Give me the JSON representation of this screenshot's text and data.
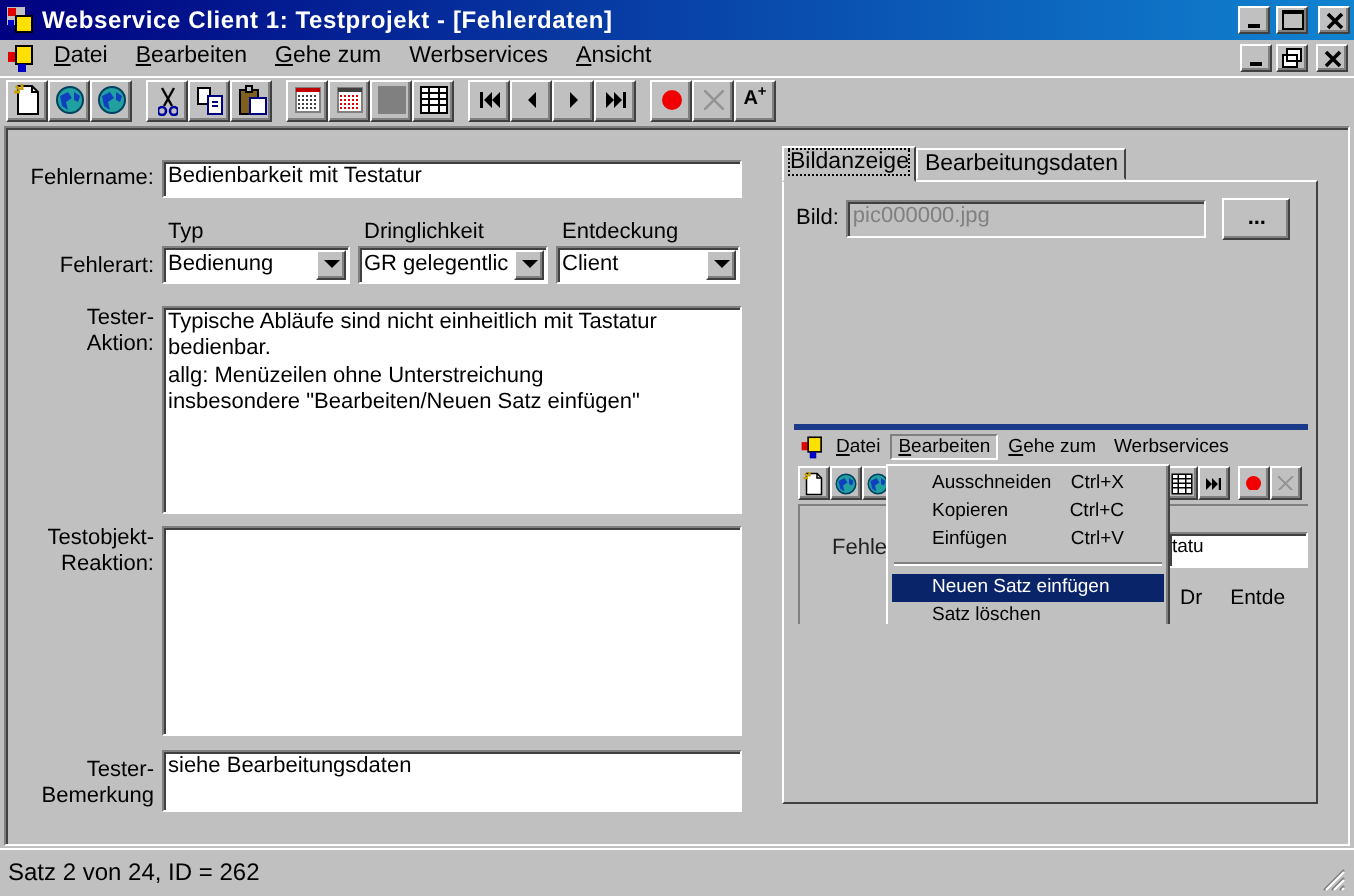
{
  "window": {
    "title": "Webservice Client 1: Testprojekt - [Fehlerdaten]"
  },
  "menu": [
    {
      "label": "Datei",
      "mnemonic": true
    },
    {
      "label": "Bearbeiten",
      "mnemonic": true
    },
    {
      "label": "Gehe zum",
      "mnemonic": true
    },
    {
      "label": "Werbservices",
      "mnemonic": false
    },
    {
      "label": "Ansicht",
      "mnemonic": true
    }
  ],
  "toolbar": [
    [
      {
        "kind": "new",
        "disabled": false
      },
      {
        "kind": "globe",
        "disabled": false
      },
      {
        "kind": "globe",
        "disabled": false
      }
    ],
    [
      {
        "kind": "cut",
        "disabled": false
      },
      {
        "kind": "copy",
        "disabled": false
      },
      {
        "kind": "paste",
        "disabled": false
      }
    ],
    [
      {
        "kind": "list",
        "disabled": false
      },
      {
        "kind": "redlist",
        "disabled": false
      },
      {
        "kind": "square",
        "disabled": false
      },
      {
        "kind": "table",
        "disabled": false
      }
    ],
    [
      {
        "kind": "first",
        "disabled": false
      },
      {
        "kind": "prev",
        "disabled": false
      },
      {
        "kind": "next",
        "disabled": false
      },
      {
        "kind": "last",
        "disabled": false
      }
    ],
    [
      {
        "kind": "record",
        "disabled": false
      },
      {
        "kind": "delete",
        "disabled": true
      },
      {
        "kind": "text",
        "label": "A$^{+}$",
        "disabled": false
      }
    ]
  ],
  "form": {
    "name": {
      "label": "Fehlername:",
      "value": "Bedienbarkeit mit Testatur"
    },
    "type": {
      "label": "Fehlerart:",
      "combos": [
        {
          "heading": "Typ",
          "value": "Bedienung"
        },
        {
          "heading": "Dringlichkeit",
          "value": "GR gelegentlic"
        },
        {
          "heading": "Entdeckung",
          "value": "Client"
        }
      ]
    },
    "memos": [
      {
        "label": "Tester-Aktion:",
        "lines": [
          "Typische Abläufe sind nicht einheitlich mit Tastatur bedienbar.",
          "allg: Menüzeilen ohne Unterstreichung",
          "insbesondere \"Bearbeiten/Neuen Satz einfügen\""
        ]
      },
      {
        "label": "Testobjekt-Reaktion:"
      },
      {
        "label": "Tester-Bemerkung",
        "lines": [
          "siehe Bearbeitungsdaten"
        ]
      }
    ]
  },
  "panel": {
    "tabs": [
      {
        "label": "Bildanzeige",
        "selected": true
      },
      {
        "label": "Bearbeitungsdaten",
        "selected": false
      }
    ],
    "image": {
      "label": "Bild:",
      "value": "pic000000.jpg",
      "disabled": true,
      "browse": "..."
    },
    "screenshot": {
      "menu": [
        {
          "label": "Datei",
          "mnemonic": true,
          "selected": false
        },
        {
          "label": "Bearbeiten",
          "mnemonic": true,
          "selected": true
        },
        {
          "label": "Gehe zum",
          "mnemonic": true,
          "selected": false
        },
        {
          "label": "Werbservices",
          "mnemonic": false,
          "selected": false
        }
      ],
      "toolbar_left": [
        {
          "kind": "new",
          "disabled": false
        },
        {
          "kind": "globe",
          "disabled": false
        },
        {
          "kind": "globe",
          "disabled": false
        }
      ],
      "toolbar_right": [
        {
          "kind": "table",
          "disabled": false
        },
        {
          "kind": "last",
          "disabled": false
        },
        {
          "kind": "record",
          "disabled": false
        },
        {
          "kind": "delete",
          "disabled": true
        }
      ],
      "dropdown": [
        {
          "kind": "item",
          "label": "Ausschneiden",
          "shortcut": "Ctrl+X",
          "selected": false
        },
        {
          "kind": "item",
          "label": "Kopieren",
          "shortcut": "Ctrl+C",
          "selected": false
        },
        {
          "kind": "item",
          "label": "Einfügen",
          "shortcut": "Ctrl+V",
          "selected": false
        },
        {
          "kind": "separator"
        },
        {
          "kind": "item",
          "label": "Neuen Satz einfügen",
          "selected": true
        },
        {
          "kind": "item",
          "label": "Satz löschen",
          "selected": false
        }
      ],
      "field_label": "Fehle",
      "field_value": "tatu",
      "headings": [
        "Dr",
        "Entde"
      ]
    }
  },
  "status_bar": "Satz 2 von 24, ID = 262"
}
